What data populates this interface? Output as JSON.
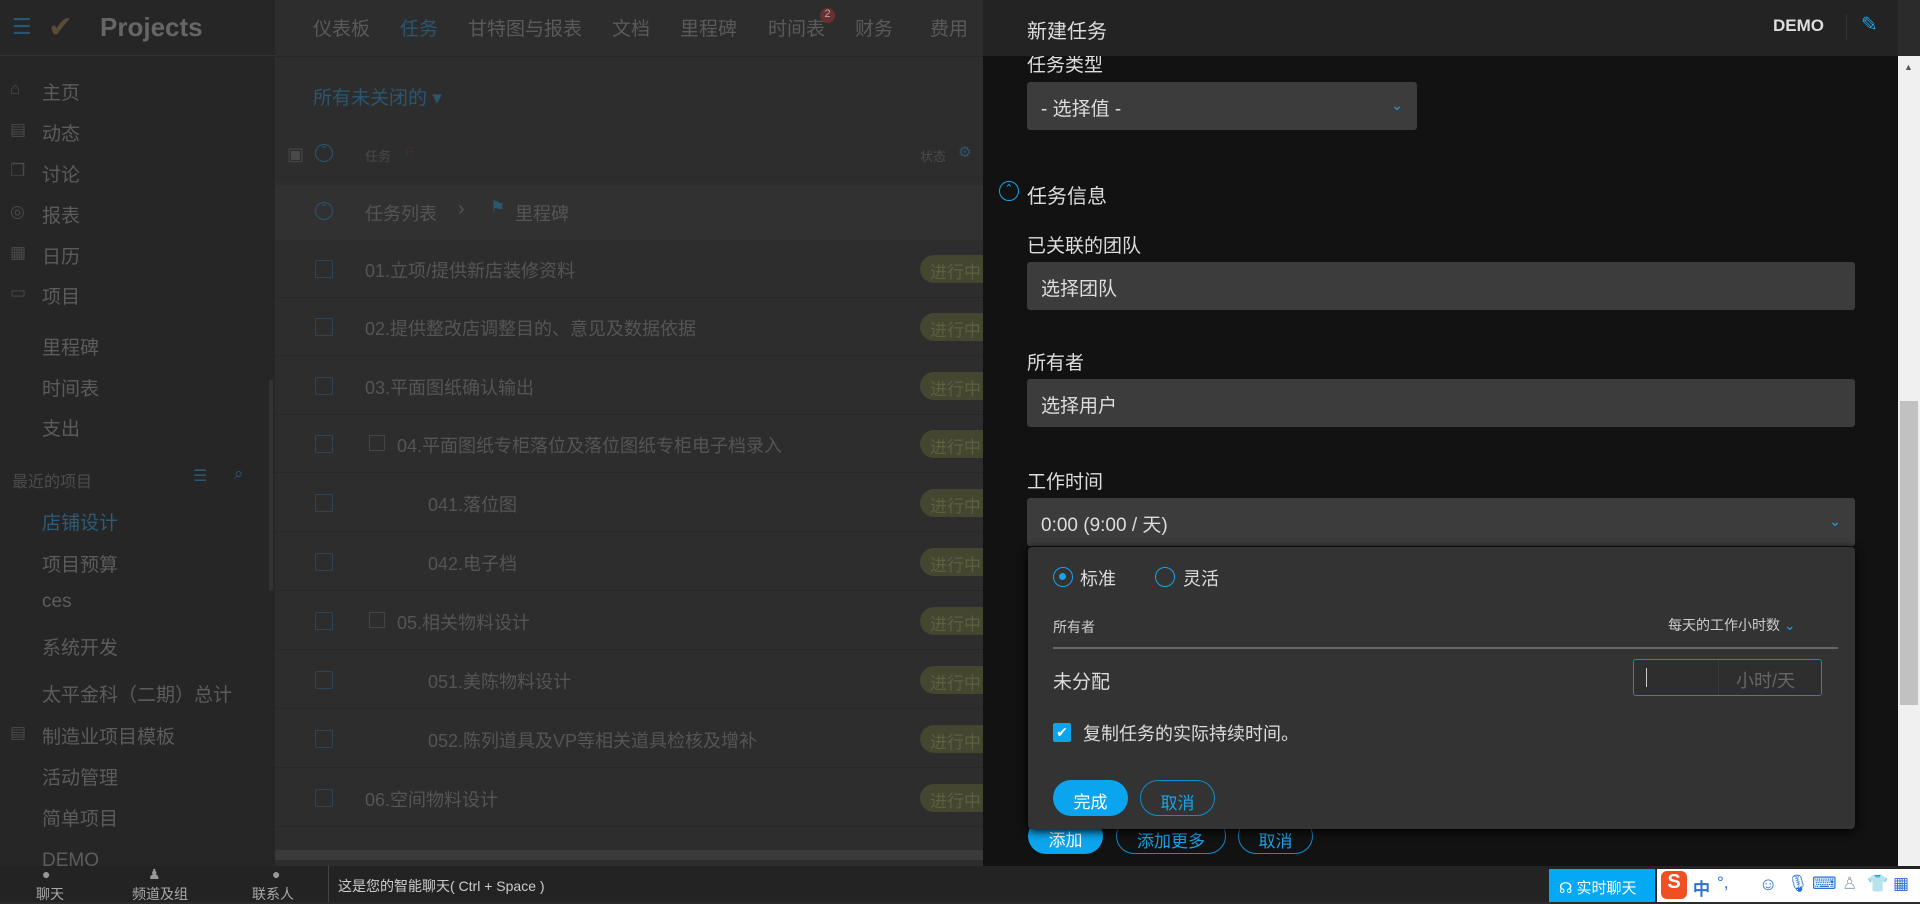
{
  "app": {
    "logo": "Projects"
  },
  "nav": {
    "items": [
      "仪表板",
      "任务",
      "甘特图与报表",
      "文档",
      "里程碑",
      "时间表",
      "财务",
      "费用"
    ],
    "active": 1,
    "timesheet_badge": "2"
  },
  "sidebar": {
    "items": [
      "主页",
      "动态",
      "讨论",
      "报表",
      "日历",
      "项目"
    ],
    "sub_items": [
      "里程碑",
      "时间表",
      "支出"
    ],
    "recent_label": "最近的项目",
    "recent": [
      "店铺设计",
      "项目预算",
      "ces",
      "系统开发",
      "太平金科（二期）总计",
      "制造业项目模板",
      "活动管理",
      "简单项目",
      "DEMO"
    ]
  },
  "main": {
    "filter": "所有未关闭的",
    "col_task": "任务",
    "col_status": "状态",
    "group": {
      "list": "任务列表",
      "sep": "›",
      "milestone": "里程碑"
    },
    "rows": [
      {
        "name": "01.立项/提供新店装修资料",
        "status": "进行中"
      },
      {
        "name": "02.提供整改店调整目的、意见及数据依据",
        "status": "进行中"
      },
      {
        "name": "03.平面图纸确认输出",
        "status": "进行中"
      },
      {
        "name": "04.平面图纸专柜落位及落位图纸专柜电子档录入",
        "status": "进行中"
      },
      {
        "name": "041.落位图",
        "status": "进行中"
      },
      {
        "name": "042.电子档",
        "status": "进行中"
      },
      {
        "name": "05.相关物料设计",
        "status": "进行中"
      },
      {
        "name": "051.美陈物料设计",
        "status": "进行中"
      },
      {
        "name": "052.陈列道具及VP等相关道具检核及增补",
        "status": "进行中"
      },
      {
        "name": "06.空间物料设计",
        "status": "进行中"
      }
    ]
  },
  "panel": {
    "title": "新建任务",
    "portal": "DEMO",
    "task_type_label": "任务类型",
    "task_type_value": "- 选择值 -",
    "section": "任务信息",
    "team_label": "已关联的团队",
    "team_value": "选择团队",
    "owner_label": "所有者",
    "owner_value": "选择用户",
    "work_label": "工作时间",
    "work_value": "0:00 (9:00 / 天)",
    "add": "添加",
    "add_more": "添加更多",
    "cancel": "取消"
  },
  "popup": {
    "radio_standard": "标准",
    "radio_flexible": "灵活",
    "col_owner": "所有者",
    "col_hours": "每天的工作小时数",
    "row_owner": "未分配",
    "hours_value": "",
    "hours_unit": "小时/天",
    "copy_label": "复制任务的实际持续时间。",
    "copy_checked": true,
    "done": "完成",
    "cancel": "取消"
  },
  "bottom": {
    "chat": "聊天",
    "channels": "频道及组",
    "contacts": "联系人",
    "hint": "这是您的智能聊天( Ctrl + Space )",
    "live_chat": "实时聊天",
    "ime": [
      "中",
      "°,"
    ]
  },
  "colors": {
    "accent": "#0aa5ee",
    "badge": "#44462f"
  }
}
